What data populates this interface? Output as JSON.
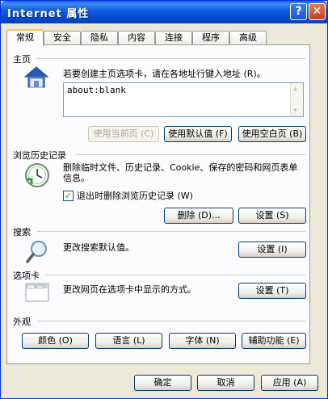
{
  "window": {
    "title": "Internet 属性",
    "help_label": "?",
    "close_label": "✕"
  },
  "tabs": [
    {
      "label": "常规"
    },
    {
      "label": "安全"
    },
    {
      "label": "隐私"
    },
    {
      "label": "内容"
    },
    {
      "label": "连接"
    },
    {
      "label": "程序"
    },
    {
      "label": "高级"
    }
  ],
  "home": {
    "heading": "主页",
    "instruction": "若要创建主页选项卡，请在各地址行键入地址 (R)。",
    "address_value": "about:blank",
    "use_current_label": "使用当前页 (C)",
    "use_default_label": "使用默认值 (F)",
    "use_blank_label": "使用空白页 (B)"
  },
  "history": {
    "heading": "浏览历史记录",
    "description": "删除临时文件、历史记录、Cookie、保存的密码和网页表单信息。",
    "checkbox_label": "退出时删除浏览历史记录 (W)",
    "checkbox_checked": true,
    "delete_label": "删除 (D)...",
    "settings_label": "设置 (S)"
  },
  "search": {
    "heading": "搜索",
    "description": "更改搜索默认值。",
    "settings_label": "设置 (I)"
  },
  "tabs_section": {
    "heading": "选项卡",
    "description": "更改网页在选项卡中显示的方式。",
    "settings_label": "设置 (T)"
  },
  "appearance": {
    "heading": "外观",
    "colors_label": "颜色 (O)",
    "languages_label": "语言 (L)",
    "fonts_label": "字体 (N)",
    "accessibility_label": "辅助功能 (E)"
  },
  "footer": {
    "ok_label": "确定",
    "cancel_label": "取消",
    "apply_label": "应用 (A)"
  }
}
